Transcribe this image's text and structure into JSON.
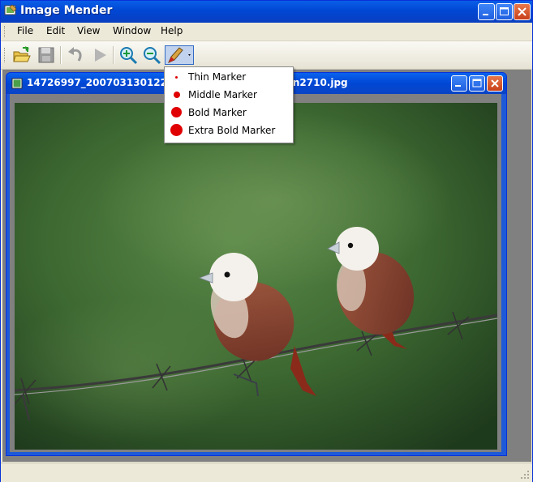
{
  "window": {
    "title": "Image Mender",
    "icon": "app-image-icon"
  },
  "menu": {
    "items": [
      "File",
      "Edit",
      "View",
      "Window",
      "Help"
    ]
  },
  "toolbar": {
    "buttons": [
      "open-folder-icon",
      "save-icon",
      "undo-icon",
      "redo-icon",
      "zoom-in-icon",
      "zoom-out-icon",
      "marker-pen-icon"
    ]
  },
  "child_window": {
    "title_left": "14726997_20070313012207",
    "title_right": "sn2710.jpg"
  },
  "marker_menu": {
    "items": [
      {
        "label": "Thin Marker"
      },
      {
        "label": "Middle Marker"
      },
      {
        "label": "Bold Marker"
      },
      {
        "label": "Extra Bold Marker"
      }
    ]
  },
  "colors": {
    "title_blue": "#0047d4",
    "marker_red": "#e00000"
  }
}
